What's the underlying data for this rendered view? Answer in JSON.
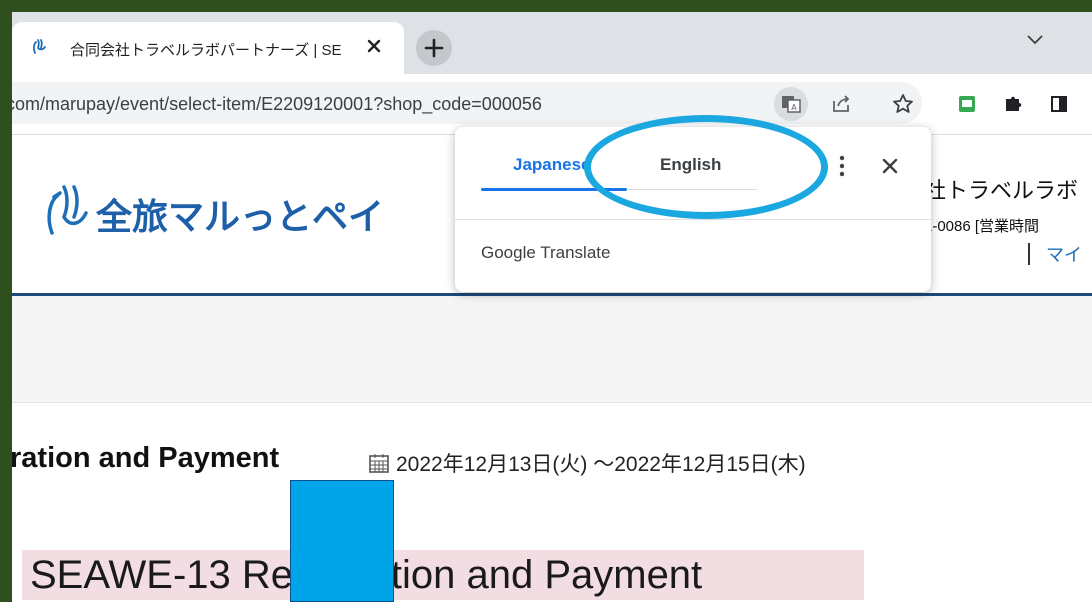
{
  "browser": {
    "tab_title": "合同会社トラベルラボパートナーズ | SE",
    "address_url": "com/marupay/event/select-item/E2209120001?shop_code=000056"
  },
  "site": {
    "logo_text": "全旅マルっとペイ",
    "company_partial": "社トラベルラボ",
    "phone_partial": "1-0086 [営業時間",
    "mypage_partial": "マイ"
  },
  "event": {
    "title_partial": "ration and Payment",
    "dates": "2022年12月13日(火) ～2022年12月15日(木)",
    "big_title": "SEAWE-13 Registration and Payment"
  },
  "translate_popup": {
    "lang_source": "Japanese",
    "lang_target": "English",
    "brand": "Google Translate"
  },
  "colors": {
    "accent_blue": "#1a73e8",
    "highlight_ellipse": "#1ba7e0",
    "redaction_block": "#00a4e8",
    "title_highlight": "#f2dde3"
  }
}
